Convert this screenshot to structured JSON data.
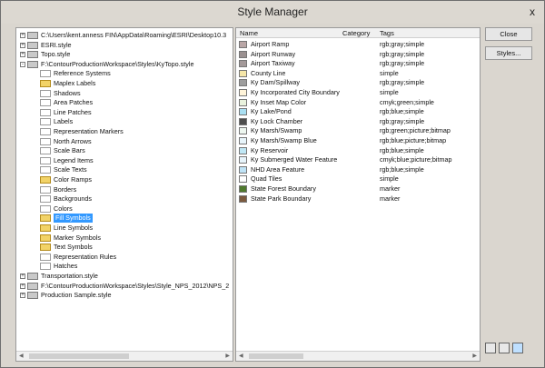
{
  "window": {
    "title": "Style Manager",
    "close_glyph": "x"
  },
  "buttons": {
    "close": "Close",
    "styles": "Styles..."
  },
  "left_tree": [
    {
      "type": "item",
      "indent": 0,
      "expander": "+",
      "folder": "gray",
      "label": "C:\\Users\\kent.anness FIN\\AppData\\Roaming\\ESRI\\Desktop10.3"
    },
    {
      "type": "item",
      "indent": 0,
      "expander": "+",
      "folder": "gray",
      "label": "ESRI.style"
    },
    {
      "type": "item",
      "indent": 0,
      "expander": "+",
      "folder": "gray",
      "label": "Topo.style"
    },
    {
      "type": "item",
      "indent": 0,
      "expander": "-",
      "folder": "gray",
      "label": "F:\\ContourProductionWorkspace\\Styles\\KyTopo.style"
    },
    {
      "type": "item",
      "indent": 1,
      "expander": "",
      "folder": "plain",
      "label": "Reference Systems"
    },
    {
      "type": "item",
      "indent": 1,
      "expander": "",
      "folder": "yellow",
      "label": "Maplex Labels"
    },
    {
      "type": "item",
      "indent": 1,
      "expander": "",
      "folder": "plain",
      "label": "Shadows"
    },
    {
      "type": "item",
      "indent": 1,
      "expander": "",
      "folder": "plain",
      "label": "Area Patches"
    },
    {
      "type": "item",
      "indent": 1,
      "expander": "",
      "folder": "plain",
      "label": "Line Patches"
    },
    {
      "type": "item",
      "indent": 1,
      "expander": "",
      "folder": "plain",
      "label": "Labels"
    },
    {
      "type": "item",
      "indent": 1,
      "expander": "",
      "folder": "plain",
      "label": "Representation Markers"
    },
    {
      "type": "item",
      "indent": 1,
      "expander": "",
      "folder": "plain",
      "label": "North Arrows"
    },
    {
      "type": "item",
      "indent": 1,
      "expander": "",
      "folder": "plain",
      "label": "Scale Bars"
    },
    {
      "type": "item",
      "indent": 1,
      "expander": "",
      "folder": "plain",
      "label": "Legend Items"
    },
    {
      "type": "item",
      "indent": 1,
      "expander": "",
      "folder": "plain",
      "label": "Scale Texts"
    },
    {
      "type": "item",
      "indent": 1,
      "expander": "",
      "folder": "yellow",
      "label": "Color Ramps"
    },
    {
      "type": "item",
      "indent": 1,
      "expander": "",
      "folder": "plain",
      "label": "Borders"
    },
    {
      "type": "item",
      "indent": 1,
      "expander": "",
      "folder": "plain",
      "label": "Backgrounds"
    },
    {
      "type": "item",
      "indent": 1,
      "expander": "",
      "folder": "plain",
      "label": "Colors"
    },
    {
      "type": "item",
      "indent": 1,
      "expander": "",
      "folder": "yellow",
      "label": "Fill Symbols",
      "selected": true
    },
    {
      "type": "item",
      "indent": 1,
      "expander": "",
      "folder": "yellow",
      "label": "Line Symbols"
    },
    {
      "type": "item",
      "indent": 1,
      "expander": "",
      "folder": "yellow",
      "label": "Marker Symbols"
    },
    {
      "type": "item",
      "indent": 1,
      "expander": "",
      "folder": "yellow",
      "label": "Text Symbols"
    },
    {
      "type": "item",
      "indent": 1,
      "expander": "",
      "folder": "plain",
      "label": "Representation Rules"
    },
    {
      "type": "item",
      "indent": 1,
      "expander": "",
      "folder": "plain",
      "label": "Hatches"
    },
    {
      "type": "item",
      "indent": 0,
      "expander": "+",
      "folder": "gray",
      "label": "Transportation.style"
    },
    {
      "type": "item",
      "indent": 0,
      "expander": "+",
      "folder": "gray",
      "label": "F:\\ContourProductionWorkspace\\Styles\\Style_NPS_2012\\NPS_2"
    },
    {
      "type": "item",
      "indent": 0,
      "expander": "+",
      "folder": "gray",
      "label": "Production Sample.style"
    }
  ],
  "right_list": {
    "columns": [
      "Name",
      "Category",
      "Tags"
    ],
    "rows": [
      {
        "name": "Airport Ramp",
        "tags": "rgb;gray;simple",
        "swatch": "#b9a6a6"
      },
      {
        "name": "Airport Runway",
        "tags": "rgb;gray;simple",
        "swatch": "#9b9191"
      },
      {
        "name": "Airport Taxiway",
        "tags": "rgb;gray;simple",
        "swatch": "#a39999"
      },
      {
        "name": "County Line",
        "tags": "simple",
        "swatch": "#f5e6a8"
      },
      {
        "name": "Ky Dam/Spillway",
        "tags": "rgb;gray;simple",
        "swatch": "#9e9e9e"
      },
      {
        "name": "Ky Incorporated City Boundary",
        "tags": "simple",
        "swatch": "#fff4d9"
      },
      {
        "name": "Ky Inset Map Color",
        "tags": "cmyk;green;simple",
        "swatch": "#e9f2dd"
      },
      {
        "name": "Ky Lake/Pond",
        "tags": "rgb;blue;simple",
        "swatch": "#a9dff2"
      },
      {
        "name": "Ky Lock Chamber",
        "tags": "rgb;gray;simple",
        "swatch": "#4e4e4e"
      },
      {
        "name": "Ky Marsh/Swamp",
        "tags": "rgb;green;picture;bitmap",
        "swatch": "#eef7f0"
      },
      {
        "name": "Ky Marsh/Swamp Blue",
        "tags": "rgb;blue;picture;bitmap",
        "swatch": "#e8f5fb"
      },
      {
        "name": "Ky Reservoir",
        "tags": "rgb;blue;simple",
        "swatch": "#bfe7f5"
      },
      {
        "name": "Ky Submerged Water Feature",
        "tags": "cmyk;blue;picture;bitmap",
        "swatch": "#e7f4fb"
      },
      {
        "name": "NHD Area Feature",
        "tags": "rgb;blue;simple",
        "swatch": "#bfe3f6"
      },
      {
        "name": "Quad Tiles",
        "tags": "simple",
        "swatch": "#ffffff"
      },
      {
        "name": "State Forest Boundary",
        "tags": "marker",
        "swatch": "#4f7a2d"
      },
      {
        "name": "State Park Boundary",
        "tags": "marker",
        "swatch": "#7c5a3e"
      }
    ]
  }
}
